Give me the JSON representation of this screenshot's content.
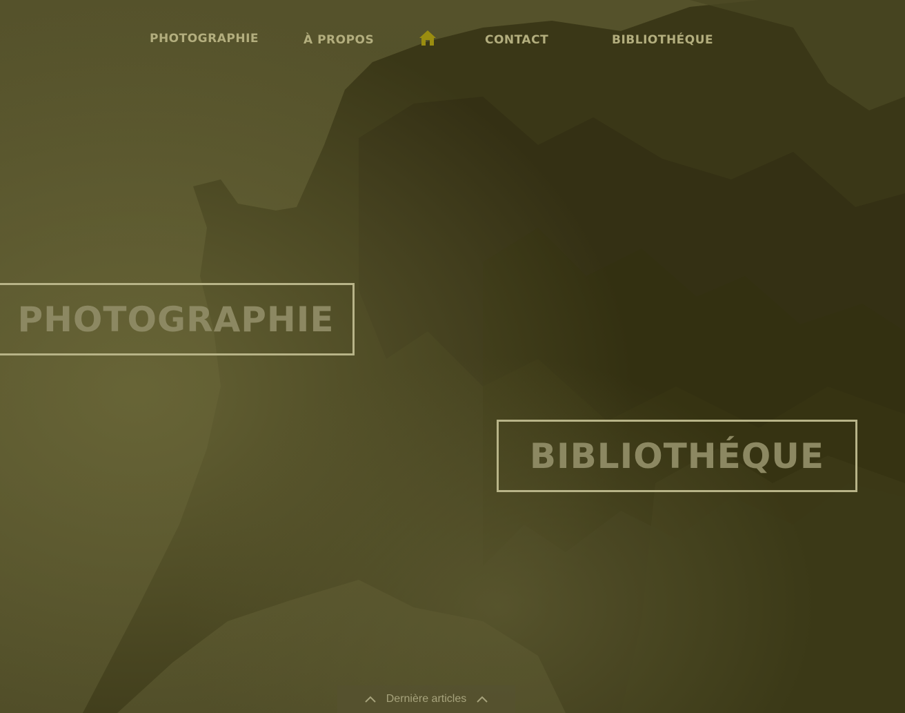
{
  "nav": {
    "items": [
      {
        "label": "PHOTOGRAPHIE"
      },
      {
        "label": "À PROPOS"
      },
      {
        "label": "CONTACT"
      },
      {
        "label": "BIBLIOTHÉQUE"
      }
    ],
    "home_icon": "home-icon"
  },
  "hero": {
    "photographie_label": "PHOTOGRAPHIE",
    "bibliotheque_label": "BIBLIOTHÉQUE"
  },
  "footer_tab": {
    "label": "Dernière articles",
    "icon_left": "chevron-up-icon",
    "icon_right": "chevron-up-icon"
  },
  "colors": {
    "overlay": "#4a4822",
    "nav_text": "#b3ae7e",
    "home_icon": "#9a8d10",
    "box_border": "#b8b488",
    "box_text": "#8c8862"
  }
}
